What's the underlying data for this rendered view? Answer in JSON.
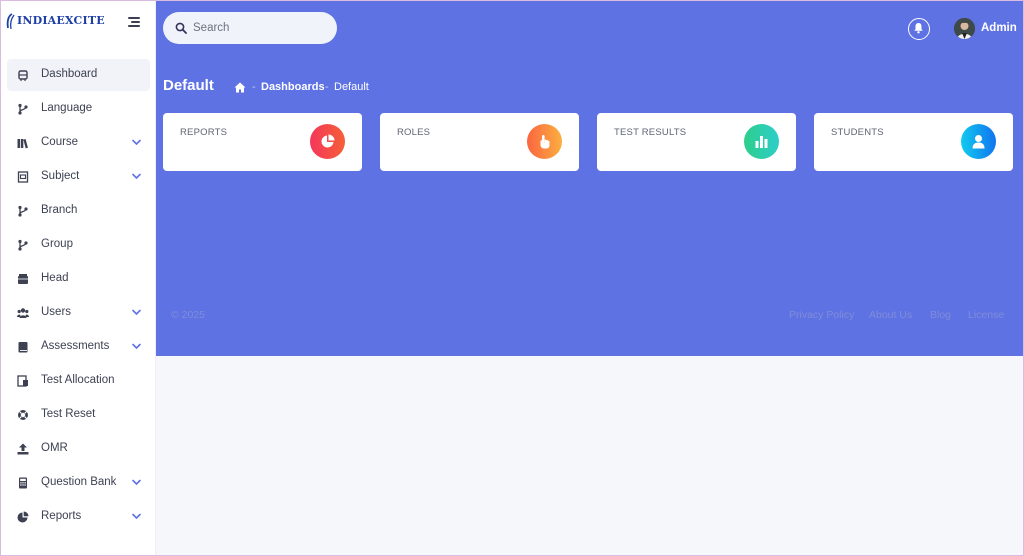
{
  "brand": {
    "name": "INDIAEXCITE"
  },
  "sidebar": {
    "items": [
      {
        "label": "Dashboard",
        "icon": "dashboard-icon",
        "active": true,
        "expandable": false
      },
      {
        "label": "Language",
        "icon": "branch-icon",
        "expandable": false
      },
      {
        "label": "Course",
        "icon": "books-icon",
        "expandable": true
      },
      {
        "label": "Subject",
        "icon": "subject-icon",
        "expandable": true
      },
      {
        "label": "Branch",
        "icon": "branch-icon",
        "expandable": false
      },
      {
        "label": "Group",
        "icon": "branch-icon",
        "expandable": false
      },
      {
        "label": "Head",
        "icon": "box-icon",
        "expandable": false
      },
      {
        "label": "Users",
        "icon": "users-icon",
        "expandable": true
      },
      {
        "label": "Assessments",
        "icon": "book-icon",
        "expandable": true
      },
      {
        "label": "Test Allocation",
        "icon": "allocation-icon",
        "expandable": false
      },
      {
        "label": "Test Reset",
        "icon": "life-ring-icon",
        "expandable": false
      },
      {
        "label": "OMR",
        "icon": "upload-icon",
        "expandable": false
      },
      {
        "label": "Question Bank",
        "icon": "calculator-icon",
        "expandable": true
      },
      {
        "label": "Reports",
        "icon": "pie-chart-icon",
        "expandable": true
      }
    ]
  },
  "header": {
    "search_placeholder": "Search",
    "user_name": "Admin"
  },
  "page": {
    "title": "Default",
    "breadcrumb": [
      "Dashboards",
      "Default"
    ],
    "breadcrumb_sep": "-"
  },
  "cards": [
    {
      "title": "REPORTS",
      "icon": "pie-chart-icon",
      "colors": [
        "#f5365c",
        "#f56036"
      ]
    },
    {
      "title": "ROLES",
      "icon": "hand-pointer-icon",
      "colors": [
        "#fb6340",
        "#fbb140"
      ]
    },
    {
      "title": "TEST RESULTS",
      "icon": "bar-chart-icon",
      "colors": [
        "#2dce89",
        "#2dcecc"
      ]
    },
    {
      "title": "STUDENTS",
      "icon": "user-icon",
      "colors": [
        "#11cdef",
        "#1171ef"
      ]
    }
  ],
  "footer": {
    "copyright": "© 2025",
    "links": [
      "Privacy Policy",
      "About Us",
      "Blog",
      "License"
    ]
  },
  "colors": {
    "primary": "#5e72e4",
    "sidebar_bg": "#ffffff",
    "content_bg": "#f6f7fb",
    "brand_text": "#1e3fa6"
  }
}
